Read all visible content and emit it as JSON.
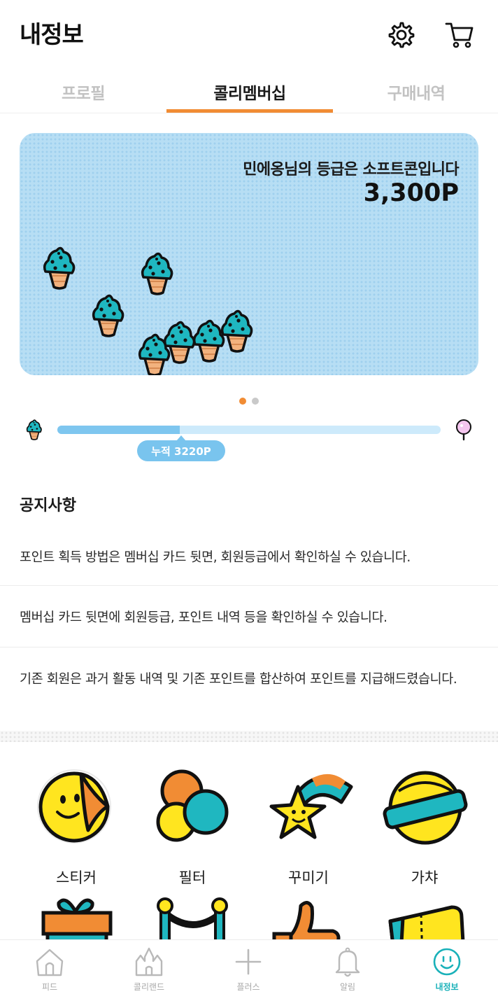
{
  "header": {
    "title": "내정보",
    "settings_icon": "gear-icon",
    "cart_icon": "cart-icon"
  },
  "tabs": [
    {
      "label": "프로필",
      "active": false
    },
    {
      "label": "콜리멤버십",
      "active": true
    },
    {
      "label": "구매내역",
      "active": false
    }
  ],
  "membership_card": {
    "grade_text": "민에옹님의 등급은 소프트콘입니다",
    "points": "3,300P",
    "background_color": "#b7def4",
    "decoration_icon": "soft-cone-icon"
  },
  "carousel": {
    "count": 2,
    "active_index": 0
  },
  "progress": {
    "label": "누적 3220P",
    "fraction": 0.32,
    "start_icon": "soft-cone-icon",
    "end_icon": "cotton-candy-icon"
  },
  "notices": {
    "title": "공지사항",
    "items": [
      "포인트 획득 방법은 멤버십 카드 뒷면, 회원등급에서 확인하실 수 있습니다.",
      "멤버십 카드 뒷면에 회원등급, 포인트 내역 등을 확인하실 수 있습니다.",
      "기존 회원은 과거 활동 내역 및 기존 포인트를 합산하여 포인트를 지급해드렸습니다."
    ]
  },
  "features": [
    {
      "label": "스티커",
      "icon": "sticker-icon"
    },
    {
      "label": "필터",
      "icon": "filter-icon"
    },
    {
      "label": "꾸미기",
      "icon": "decorate-icon"
    },
    {
      "label": "가챠",
      "icon": "gacha-icon"
    },
    {
      "label": "",
      "icon": "gift-icon"
    },
    {
      "label": "",
      "icon": "rope-barrier-icon"
    },
    {
      "label": "",
      "icon": "thumbs-up-icon"
    },
    {
      "label": "",
      "icon": "ticket-icon"
    }
  ],
  "bottom_nav": [
    {
      "label": "피드",
      "icon": "home-icon",
      "active": false
    },
    {
      "label": "콜리랜드",
      "icon": "castle-icon",
      "active": false
    },
    {
      "label": "플러스",
      "icon": "plus-icon",
      "active": false
    },
    {
      "label": "알림",
      "icon": "bell-icon",
      "active": false
    },
    {
      "label": "내정보",
      "icon": "smile-icon",
      "active": true
    }
  ],
  "colors": {
    "accent": "#f18c34",
    "active_nav": "#19b1b9",
    "progress": "#7ec6ef"
  }
}
